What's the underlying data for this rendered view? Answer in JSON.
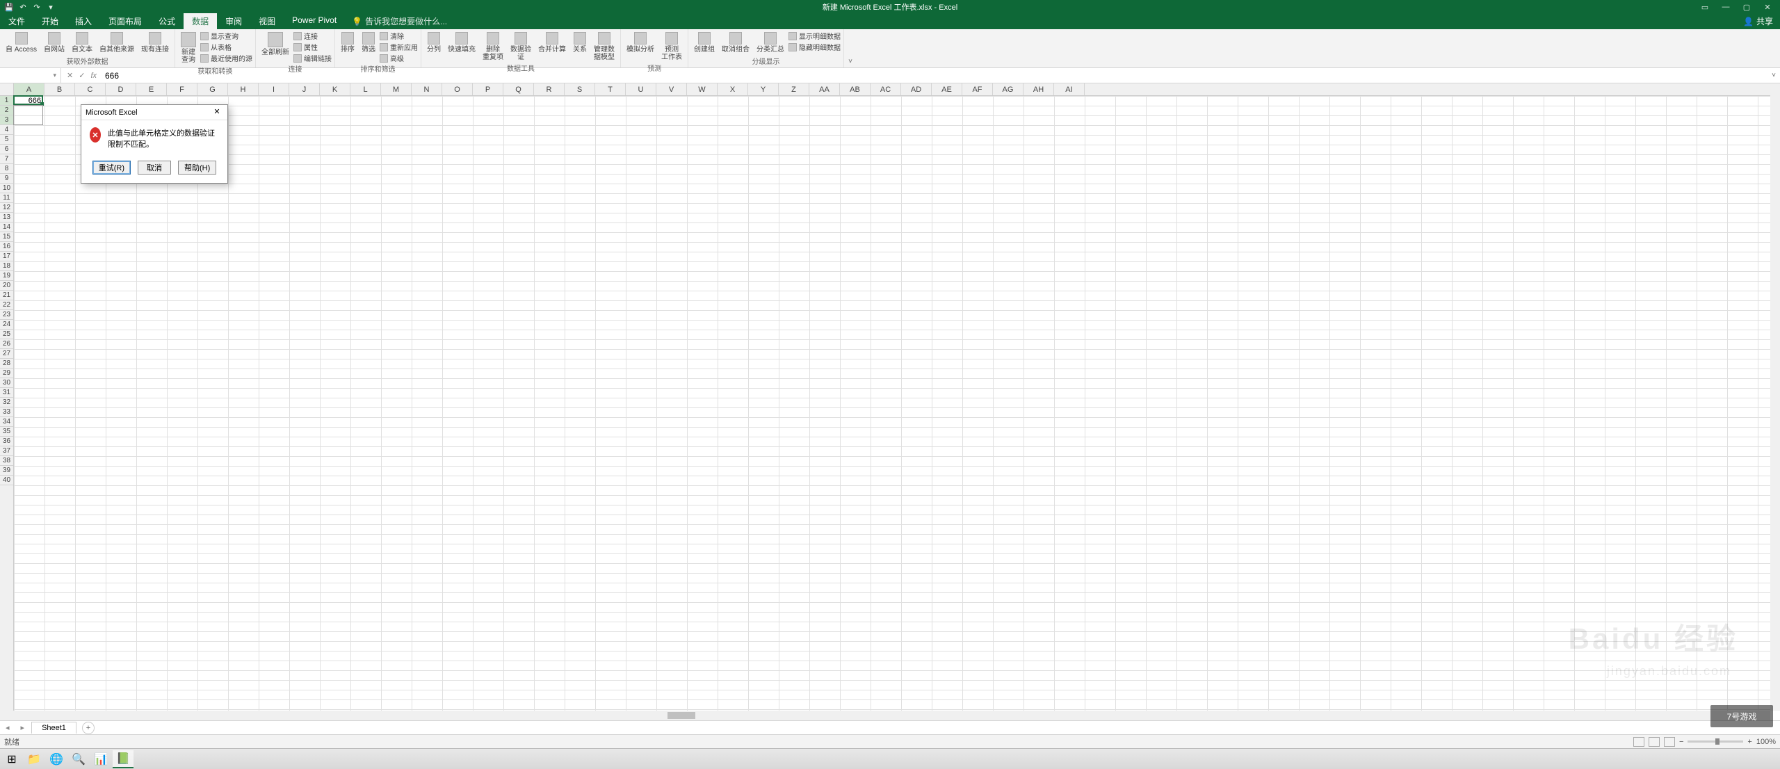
{
  "titlebar": {
    "title": "新建 Microsoft Excel 工作表.xlsx - Excel",
    "share": "共享"
  },
  "menu": {
    "tabs": [
      "文件",
      "开始",
      "插入",
      "页面布局",
      "公式",
      "数据",
      "审阅",
      "视图",
      "Power Pivot"
    ],
    "active_index": 5,
    "tellme": "告诉我您想要做什么..."
  },
  "ribbon": {
    "groups": [
      {
        "label": "获取外部数据",
        "buttons": [
          "自 Access",
          "自网站",
          "自文本",
          "自其他来源",
          "现有连接"
        ]
      },
      {
        "label": "获取和转换",
        "big": "新建\n查询",
        "rows": [
          "显示查询",
          "从表格",
          "最近使用的源"
        ]
      },
      {
        "label": "连接",
        "big": "全部刷新",
        "rows": [
          "连接",
          "属性",
          "编辑链接"
        ]
      },
      {
        "label": "排序和筛选",
        "buttons": [
          "排序",
          "筛选"
        ],
        "rows": [
          "清除",
          "重新应用",
          "高级"
        ]
      },
      {
        "label": "数据工具",
        "buttons": [
          "分列",
          "快速填充",
          "删除\n重复项",
          "数据验\n证",
          "合并计算",
          "关系",
          "管理数\n据模型"
        ]
      },
      {
        "label": "预测",
        "buttons": [
          "模拟分析",
          "预测\n工作表"
        ]
      },
      {
        "label": "分级显示",
        "buttons": [
          "创建组",
          "取消组合",
          "分类汇总"
        ],
        "rows": [
          "显示明细数据",
          "隐藏明细数据"
        ]
      }
    ]
  },
  "formula_bar": {
    "namebox": "",
    "value": "666"
  },
  "grid": {
    "columns": [
      "A",
      "B",
      "C",
      "D",
      "E",
      "F",
      "G",
      "H",
      "I",
      "J",
      "K",
      "L",
      "M",
      "N",
      "O",
      "P",
      "Q",
      "R",
      "S",
      "T",
      "U",
      "V",
      "W",
      "X",
      "Y",
      "Z",
      "AA",
      "AB",
      "AC",
      "AD",
      "AE",
      "AF",
      "AG",
      "AH",
      "AI"
    ],
    "rows": 40,
    "active_cell": {
      "col": "A",
      "row": 1,
      "value": "666"
    },
    "selection_end_row": 3
  },
  "sheets": {
    "active": "Sheet1"
  },
  "statusbar": {
    "mode": "就绪",
    "zoom": "100%"
  },
  "dialog": {
    "title": "Microsoft Excel",
    "message": "此值与此单元格定义的数据验证限制不匹配。",
    "buttons": {
      "retry": "重试(R)",
      "cancel": "取消",
      "help": "帮助(H)"
    }
  },
  "watermark": {
    "brand": "Baidu 经验",
    "url": "jingyan.baidu.com",
    "corner": "7号游戏"
  }
}
